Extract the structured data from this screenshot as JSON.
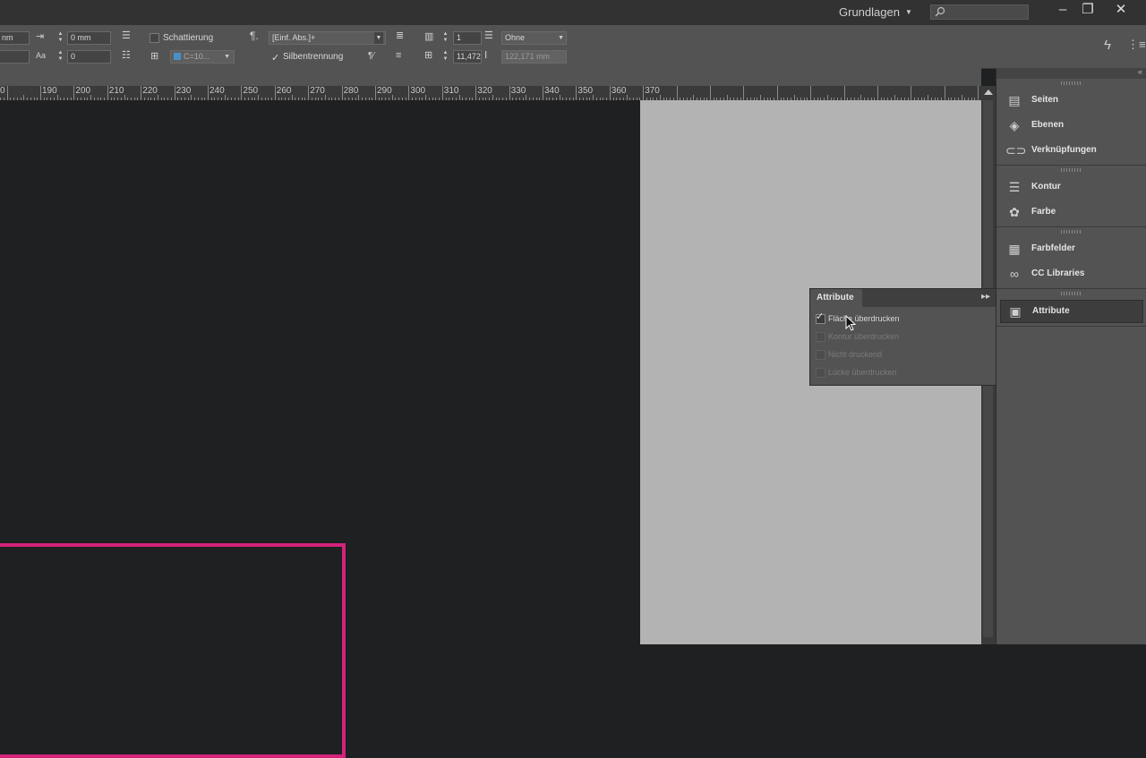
{
  "titlebar": {
    "workspace": "Grundlagen",
    "search_placeholder": "",
    "minimize": "–",
    "restore": "❐",
    "close": "✕"
  },
  "controlbar": {
    "space_before_value": "0 mm",
    "space_after_value": "0",
    "left_field_top": "nm",
    "shading_label": "Schattierung",
    "shading_color": "C=10...",
    "paragraph_style": "[Einf. Abs.]+",
    "hyphenation_label": "Silbentrennung",
    "columns_value": "1",
    "gutter_value": "11,472",
    "span_option": "Ohne",
    "column_width_value": "122,171 mm"
  },
  "ruler": {
    "labels": [
      "0",
      "190",
      "200",
      "210",
      "220",
      "230",
      "240",
      "250",
      "260",
      "270",
      "280",
      "290",
      "300",
      "310",
      "320",
      "330",
      "340",
      "350",
      "360",
      "370"
    ]
  },
  "right_panel": {
    "items": [
      {
        "label": "Seiten",
        "icon": "pages-icon"
      },
      {
        "label": "Ebenen",
        "icon": "layers-icon"
      },
      {
        "label": "Verknüpfungen",
        "icon": "links-icon"
      },
      {
        "label": "Kontur",
        "icon": "stroke-icon"
      },
      {
        "label": "Farbe",
        "icon": "color-icon"
      },
      {
        "label": "Farbfelder",
        "icon": "swatches-icon"
      },
      {
        "label": "CC Libraries",
        "icon": "cc-libraries-icon"
      },
      {
        "label": "Attribute",
        "icon": "attributes-icon"
      }
    ]
  },
  "attribute_panel": {
    "title": "Attribute",
    "options": [
      {
        "label": "Fläche überdrucken",
        "checked": true,
        "enabled": true
      },
      {
        "label": "Kontur überdrucken",
        "checked": false,
        "enabled": false
      },
      {
        "label": "Nicht druckend",
        "checked": false,
        "enabled": false
      },
      {
        "label": "Lücke überdrucken",
        "checked": false,
        "enabled": false
      }
    ]
  },
  "colors": {
    "frame_stroke": "#d3237b",
    "page": "#b3b3b3",
    "canvas": "#1e2022"
  }
}
